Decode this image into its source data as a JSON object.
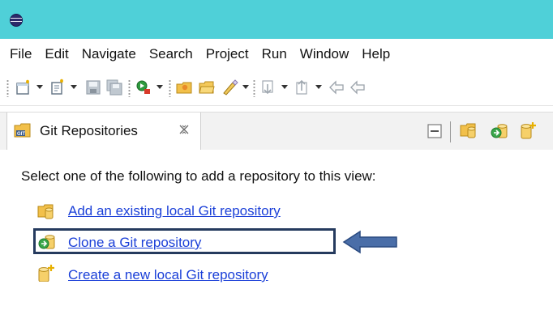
{
  "window": {
    "icons": {
      "logo": "eclipse-logo-icon"
    },
    "colors": {
      "titlebar": "#4fd0d8"
    }
  },
  "menubar": {
    "items": [
      "File",
      "Edit",
      "Navigate",
      "Search",
      "Project",
      "Run",
      "Window",
      "Help"
    ]
  },
  "toolbar": {
    "icons": [
      "new-icon",
      "new-wizard-icon",
      "save-icon",
      "save-all-icon",
      "run-icon",
      "open-type-icon",
      "open-folder-icon",
      "pen-icon",
      "next-annotation-icon",
      "previous-annotation-icon",
      "back-icon"
    ]
  },
  "view": {
    "tab": {
      "label": "Git Repositories",
      "icon": "git-repositories-icon",
      "close_icon": "close-icon"
    },
    "tools": [
      "minimize-icon",
      "add-repository-icon",
      "clone-repository-icon",
      "create-repository-icon"
    ],
    "prompt": "Select one of the following to add a repository to this view:",
    "options": [
      {
        "label": "Add an existing local Git repository",
        "icon": "add-repository-icon"
      },
      {
        "label": "Clone a Git repository",
        "icon": "clone-repository-icon",
        "highlighted": true
      },
      {
        "label": "Create a new local Git repository",
        "icon": "create-repository-icon"
      }
    ],
    "colors": {
      "link": "#1a3fd8",
      "highlight_border": "#253a5e",
      "arrow": "#4a6ea8"
    }
  }
}
